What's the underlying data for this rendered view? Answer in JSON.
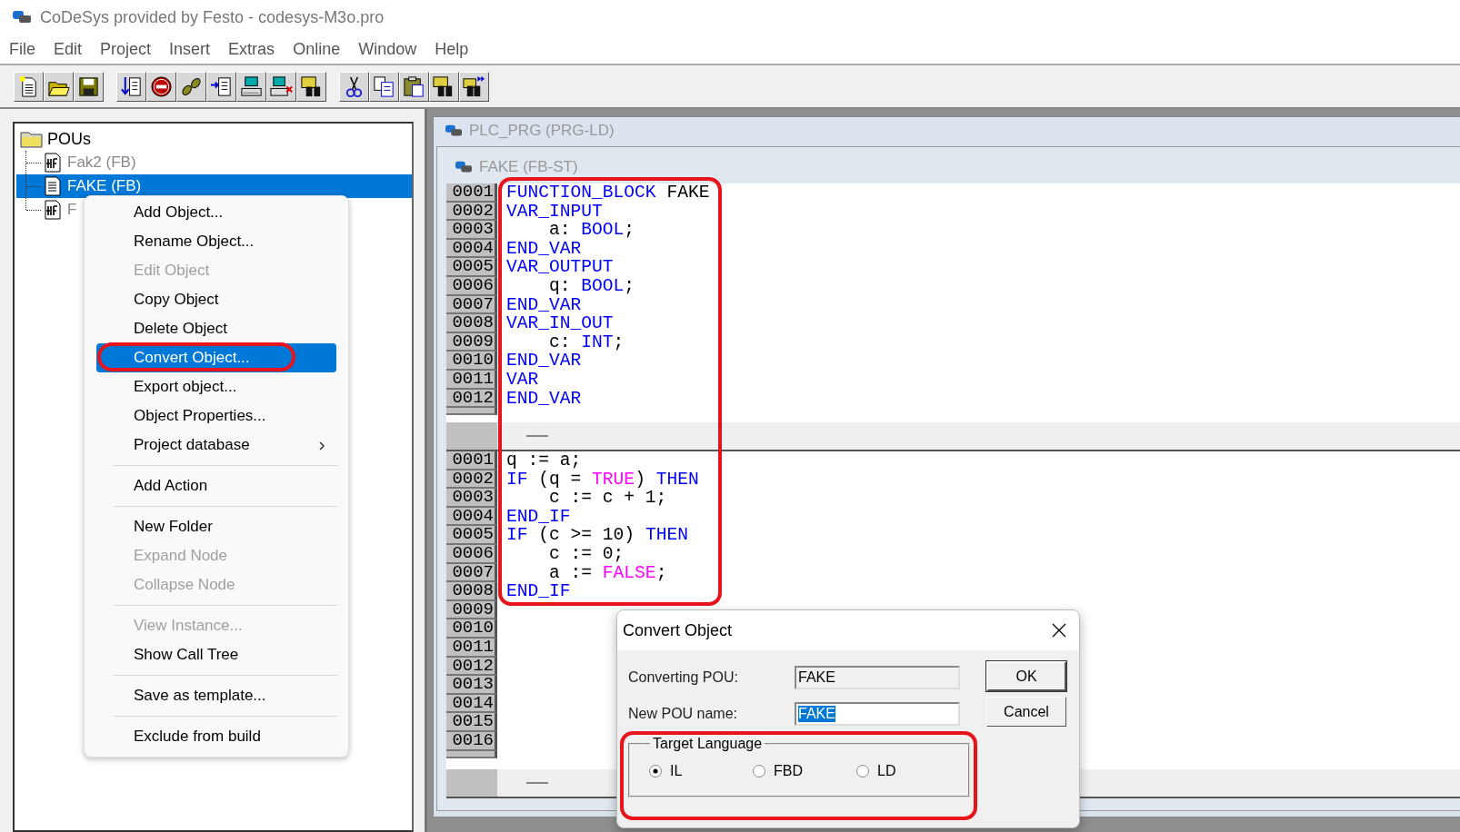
{
  "window": {
    "title": "CoDeSys provided by Festo - codesys-M3o.pro"
  },
  "menu_bar": [
    {
      "label": "File"
    },
    {
      "label": "Edit"
    },
    {
      "label": "Project"
    },
    {
      "label": "Insert"
    },
    {
      "label": "Extras"
    },
    {
      "label": "Online"
    },
    {
      "label": "Window"
    },
    {
      "label": "Help"
    }
  ],
  "object_tree": {
    "label": "POUs",
    "expanded": true,
    "children": [
      {
        "label": "Fak2 (FB)",
        "kind": "fbd",
        "selected": false
      },
      {
        "label": "FAKE (FB)",
        "kind": "st",
        "selected": true
      },
      {
        "label": "F",
        "kind": "fbd",
        "selected": false
      }
    ]
  },
  "context_menu": [
    {
      "kind": "item",
      "label": "Add Object...",
      "disabled": false,
      "selected": false,
      "submenu": false
    },
    {
      "kind": "item",
      "label": "Rename Object...",
      "disabled": false,
      "selected": false,
      "submenu": false
    },
    {
      "kind": "item",
      "label": "Edit Object",
      "disabled": true,
      "selected": false,
      "submenu": false
    },
    {
      "kind": "item",
      "label": "Copy Object",
      "disabled": false,
      "selected": false,
      "submenu": false
    },
    {
      "kind": "item",
      "label": "Delete Object",
      "disabled": false,
      "selected": false,
      "submenu": false
    },
    {
      "kind": "item",
      "label": "Convert Object...",
      "disabled": false,
      "selected": true,
      "submenu": false
    },
    {
      "kind": "item",
      "label": "Export object...",
      "disabled": false,
      "selected": false,
      "submenu": false
    },
    {
      "kind": "item",
      "label": "Object Properties...",
      "disabled": false,
      "selected": false,
      "submenu": false
    },
    {
      "kind": "item",
      "label": "Project database",
      "disabled": false,
      "selected": false,
      "submenu": true
    },
    {
      "kind": "separator"
    },
    {
      "kind": "item",
      "label": "Add Action",
      "disabled": false,
      "selected": false,
      "submenu": false
    },
    {
      "kind": "separator"
    },
    {
      "kind": "item",
      "label": "New Folder",
      "disabled": false,
      "selected": false,
      "submenu": false
    },
    {
      "kind": "item",
      "label": "Expand Node",
      "disabled": true,
      "selected": false,
      "submenu": false
    },
    {
      "kind": "item",
      "label": "Collapse Node",
      "disabled": true,
      "selected": false,
      "submenu": false
    },
    {
      "kind": "separator"
    },
    {
      "kind": "item",
      "label": "View Instance...",
      "disabled": true,
      "selected": false,
      "submenu": false
    },
    {
      "kind": "item",
      "label": "Show Call Tree",
      "disabled": false,
      "selected": false,
      "submenu": false
    },
    {
      "kind": "separator"
    },
    {
      "kind": "item",
      "label": "Save as template...",
      "disabled": false,
      "selected": false,
      "submenu": false
    },
    {
      "kind": "separator"
    },
    {
      "kind": "item",
      "label": "Exclude from build",
      "disabled": false,
      "selected": false,
      "submenu": false
    }
  ],
  "editor_windows": [
    {
      "title": "PLC_PRG (PRG-LD)"
    },
    {
      "title": "FAKE (FB-ST)"
    }
  ],
  "declaration_pane": [
    {
      "number": "0001",
      "tokens": [
        {
          "kind": "keyword",
          "text": "FUNCTION_BLOCK"
        },
        {
          "kind": "plain",
          "text": " FAKE"
        }
      ]
    },
    {
      "number": "0002",
      "tokens": [
        {
          "kind": "keyword",
          "text": "VAR_INPUT"
        }
      ]
    },
    {
      "number": "0003",
      "tokens": [
        {
          "kind": "plain",
          "text": "    a: "
        },
        {
          "kind": "keyword",
          "text": "BOOL"
        },
        {
          "kind": "plain",
          "text": ";"
        }
      ]
    },
    {
      "number": "0004",
      "tokens": [
        {
          "kind": "keyword",
          "text": "END_VAR"
        }
      ]
    },
    {
      "number": "0005",
      "tokens": [
        {
          "kind": "keyword",
          "text": "VAR_OUTPUT"
        }
      ]
    },
    {
      "number": "0006",
      "tokens": [
        {
          "kind": "plain",
          "text": "    q: "
        },
        {
          "kind": "keyword",
          "text": "BOOL"
        },
        {
          "kind": "plain",
          "text": ";"
        }
      ]
    },
    {
      "number": "0007",
      "tokens": [
        {
          "kind": "keyword",
          "text": "END_VAR"
        }
      ]
    },
    {
      "number": "0008",
      "tokens": [
        {
          "kind": "keyword",
          "text": "VAR_IN_OUT"
        }
      ]
    },
    {
      "number": "0009",
      "tokens": [
        {
          "kind": "plain",
          "text": "    c: "
        },
        {
          "kind": "keyword",
          "text": "INT"
        },
        {
          "kind": "plain",
          "text": ";"
        }
      ]
    },
    {
      "number": "0010",
      "tokens": [
        {
          "kind": "keyword",
          "text": "END_VAR"
        }
      ]
    },
    {
      "number": "0011",
      "tokens": [
        {
          "kind": "keyword",
          "text": "VAR"
        }
      ]
    },
    {
      "number": "0012",
      "tokens": [
        {
          "kind": "keyword",
          "text": "END_VAR"
        }
      ]
    }
  ],
  "body_pane": [
    {
      "number": "0001",
      "tokens": [
        {
          "kind": "plain",
          "text": "q := a;"
        }
      ]
    },
    {
      "number": "0002",
      "tokens": [
        {
          "kind": "keyword",
          "text": "IF"
        },
        {
          "kind": "plain",
          "text": " (q = "
        },
        {
          "kind": "literal",
          "text": "TRUE"
        },
        {
          "kind": "plain",
          "text": ") "
        },
        {
          "kind": "keyword",
          "text": "THEN"
        }
      ]
    },
    {
      "number": "0003",
      "tokens": [
        {
          "kind": "plain",
          "text": "    c := c + 1;"
        }
      ]
    },
    {
      "number": "0004",
      "tokens": [
        {
          "kind": "keyword",
          "text": "END_IF"
        }
      ]
    },
    {
      "number": "0005",
      "tokens": [
        {
          "kind": "keyword",
          "text": "IF"
        },
        {
          "kind": "plain",
          "text": " (c >= 10) "
        },
        {
          "kind": "keyword",
          "text": "THEN"
        }
      ]
    },
    {
      "number": "0006",
      "tokens": [
        {
          "kind": "plain",
          "text": "    c := 0;"
        }
      ]
    },
    {
      "number": "0007",
      "tokens": [
        {
          "kind": "plain",
          "text": "    a := "
        },
        {
          "kind": "literal",
          "text": "FALSE"
        },
        {
          "kind": "plain",
          "text": ";"
        }
      ]
    },
    {
      "number": "0008",
      "tokens": [
        {
          "kind": "keyword",
          "text": "END_IF"
        }
      ]
    },
    {
      "number": "0009"
    },
    {
      "number": "0010"
    },
    {
      "number": "0011"
    },
    {
      "number": "0012"
    },
    {
      "number": "0013"
    },
    {
      "number": "0014"
    },
    {
      "number": "0015"
    },
    {
      "number": "0016"
    }
  ],
  "dialog": {
    "title": "Convert Object",
    "fields": [
      {
        "label": "Converting POU:",
        "value": "FAKE",
        "disabled": true,
        "text_selected": false
      },
      {
        "label": "New POU name:",
        "value": "FAKE",
        "disabled": false,
        "text_selected": true
      }
    ],
    "buttons": [
      "OK",
      "Cancel"
    ],
    "group": {
      "label": "Target Language",
      "options": [
        {
          "label": "IL",
          "selected": true
        },
        {
          "label": "FBD",
          "selected": false
        },
        {
          "label": "LD",
          "selected": false
        }
      ]
    }
  }
}
